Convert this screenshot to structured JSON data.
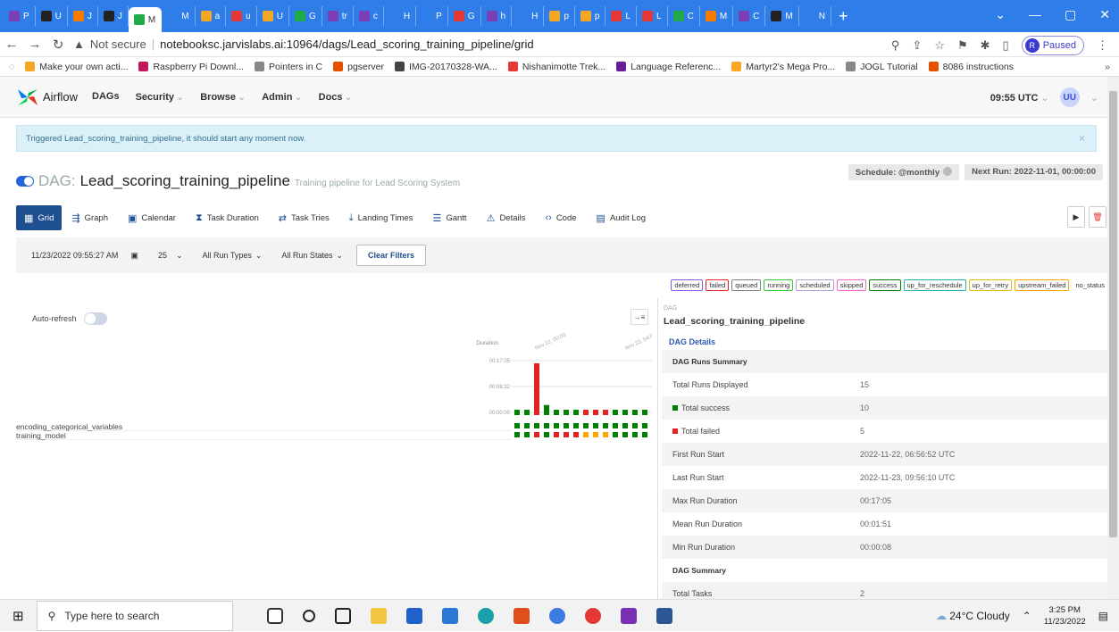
{
  "browser": {
    "tabs": [
      "P",
      "U",
      "J",
      "J",
      "M",
      "M",
      "a",
      "u",
      "U",
      "G",
      "tr",
      "c",
      "H",
      "P",
      "G",
      "h",
      "H",
      "p",
      "p",
      "L",
      "L",
      "C",
      "M",
      "C",
      "M",
      "N"
    ],
    "active_tab_index": 4,
    "new_tab": "+",
    "url_security": "Not secure",
    "url": "notebooksc.jarvislabs.ai:10964/dags/Lead_scoring_training_pipeline/grid",
    "profile_status": "Paused",
    "profile_initial": "R",
    "bookmarks": [
      "Make your own acti...",
      "Raspberry Pi Downl...",
      "Pointers in C",
      "pgserver",
      "IMG-20170328-WA...",
      "Nishanimotte Trek...",
      "Language Referenc...",
      "Martyr2's Mega Pro...",
      "JOGL Tutorial",
      "8086 instructions"
    ],
    "bookmark_more": "»"
  },
  "airflow": {
    "brand": "Airflow",
    "menu": [
      "DAGs",
      "Security",
      "Browse",
      "Admin",
      "Docs"
    ],
    "time": "09:55 UTC",
    "user": "UU",
    "alert": "Triggered Lead_scoring_training_pipeline, it should start any moment now.",
    "alert_close": "×",
    "dag_label": "DAG:",
    "dag_id": "Lead_scoring_training_pipeline",
    "dag_desc": "Training pipeline for Lead Scoring System",
    "schedule": "Schedule: @monthly",
    "next_run": "Next Run: 2022-11-01, 00:00:00",
    "view_tabs": [
      {
        "icon": "▦",
        "label": "Grid"
      },
      {
        "icon": "⇶",
        "label": "Graph"
      },
      {
        "icon": "▣",
        "label": "Calendar"
      },
      {
        "icon": "⧗",
        "label": "Task Duration"
      },
      {
        "icon": "⇄",
        "label": "Task Tries"
      },
      {
        "icon": "⤓",
        "label": "Landing Times"
      },
      {
        "icon": "☰",
        "label": "Gantt"
      },
      {
        "icon": "⚠",
        "label": "Details"
      },
      {
        "icon": "‹›",
        "label": "Code"
      },
      {
        "icon": "▤",
        "label": "Audit Log"
      }
    ],
    "filters": {
      "date": "11/23/2022 09:55:27 AM",
      "num_runs": "25",
      "run_types": "All Run Types",
      "run_states": "All Run States",
      "clear": "Clear Filters"
    },
    "legend": [
      {
        "label": "deferred",
        "color": "#8a5be0"
      },
      {
        "label": "failed",
        "color": "#e52222"
      },
      {
        "label": "queued",
        "color": "#808080"
      },
      {
        "label": "running",
        "color": "#33cc33"
      },
      {
        "label": "scheduled",
        "color": "#b0a0d0"
      },
      {
        "label": "skipped",
        "color": "#ff66cc"
      },
      {
        "label": "success",
        "color": "#008000"
      },
      {
        "label": "up_for_reschedule",
        "color": "#20b2aa"
      },
      {
        "label": "up_for_retry",
        "color": "#e6b800"
      },
      {
        "label": "upstream_failed",
        "color": "#ffa500"
      },
      {
        "label": "no_status",
        "color": "#ffffff"
      }
    ],
    "auto_refresh": "Auto-refresh",
    "collapse_icon": "→≡",
    "grid": {
      "duration_label": "Duration",
      "ticks": [
        "00:17:05",
        "00:08:32",
        "00:00:00"
      ],
      "first_run_label": "Nov 22, 00:00",
      "last_run_label": "Nov 23, 04:54",
      "tasks": [
        "encoding_categorical_variables",
        "training_model"
      ],
      "runs": [
        {
          "duration_s": 4,
          "state": "success",
          "tasks": [
            "success",
            "success"
          ]
        },
        {
          "duration_s": 4,
          "state": "success",
          "tasks": [
            "success",
            "success"
          ]
        },
        {
          "duration_s": 1025,
          "state": "failed",
          "tasks": [
            "success",
            "failed"
          ]
        },
        {
          "duration_s": 200,
          "state": "success",
          "tasks": [
            "success",
            "success"
          ]
        },
        {
          "duration_s": 8,
          "state": "success",
          "tasks": [
            "success",
            "failed"
          ]
        },
        {
          "duration_s": 4,
          "state": "success",
          "tasks": [
            "success",
            "failed"
          ]
        },
        {
          "duration_s": 4,
          "state": "success",
          "tasks": [
            "success",
            "failed"
          ]
        },
        {
          "duration_s": 4,
          "state": "failed",
          "tasks": [
            "success",
            "upstream_failed"
          ]
        },
        {
          "duration_s": 4,
          "state": "failed",
          "tasks": [
            "success",
            "upstream_failed"
          ]
        },
        {
          "duration_s": 4,
          "state": "failed",
          "tasks": [
            "success",
            "upstream_failed"
          ]
        },
        {
          "duration_s": 4,
          "state": "success",
          "tasks": [
            "success",
            "success"
          ]
        },
        {
          "duration_s": 4,
          "state": "success",
          "tasks": [
            "success",
            "success"
          ]
        },
        {
          "duration_s": 4,
          "state": "success",
          "tasks": [
            "success",
            "success"
          ]
        },
        {
          "duration_s": 4,
          "state": "success",
          "tasks": [
            "success",
            "success"
          ]
        },
        {
          "duration_s": 4,
          "state": "success",
          "tasks": [
            "success",
            "success"
          ]
        }
      ]
    },
    "details": {
      "small_label": "DAG",
      "dag_name": "Lead_scoring_training_pipeline",
      "section": "DAG Details",
      "rows": [
        {
          "k": "DAG Runs Summary",
          "v": "",
          "header": true
        },
        {
          "k": "Total Runs Displayed",
          "v": "15"
        },
        {
          "k": "Total success",
          "v": "10",
          "sq": "#008000"
        },
        {
          "k": "Total failed",
          "v": "5",
          "sq": "#e52222"
        },
        {
          "k": "First Run Start",
          "v": "2022-11-22, 06:56:52 UTC"
        },
        {
          "k": "Last Run Start",
          "v": "2022-11-23, 09:56:10 UTC"
        },
        {
          "k": "Max Run Duration",
          "v": "00:17:05"
        },
        {
          "k": "Mean Run Duration",
          "v": "00:01:51"
        },
        {
          "k": "Min Run Duration",
          "v": "00:00:08"
        },
        {
          "k": "DAG Summary",
          "v": "",
          "header": true
        },
        {
          "k": "Total Tasks",
          "v": "2"
        }
      ]
    }
  },
  "taskbar": {
    "search_placeholder": "Type here to search",
    "weather": "24°C Cloudy",
    "time": "3:25 PM",
    "date": "11/23/2022"
  }
}
